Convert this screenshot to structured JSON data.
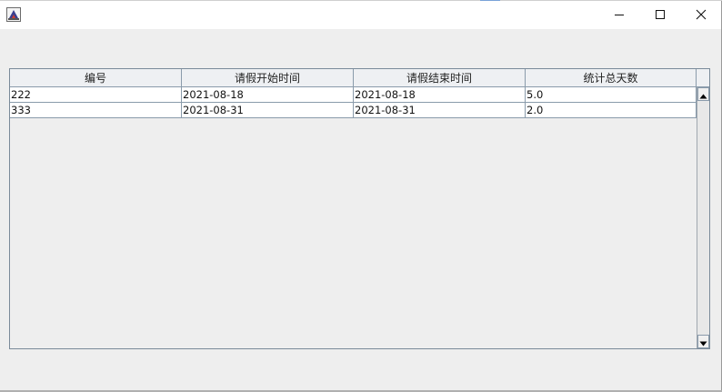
{
  "window": {
    "title": "",
    "icon": "java-app-icon",
    "controls": {
      "minimize": "minimize-icon",
      "maximize": "maximize-icon",
      "close": "close-icon"
    }
  },
  "table": {
    "columns": [
      "编号",
      "请假开始时间",
      "请假结束时间",
      "统计总天数"
    ],
    "rows": [
      [
        "222",
        "2021-08-18",
        "2021-08-18",
        "5.0"
      ],
      [
        "333",
        "2021-08-31",
        "2021-08-31",
        "2.0"
      ]
    ]
  },
  "colors": {
    "window_bg": "#eeeeee",
    "titlebar_bg": "#ffffff",
    "grid_line": "#8a9bab"
  }
}
